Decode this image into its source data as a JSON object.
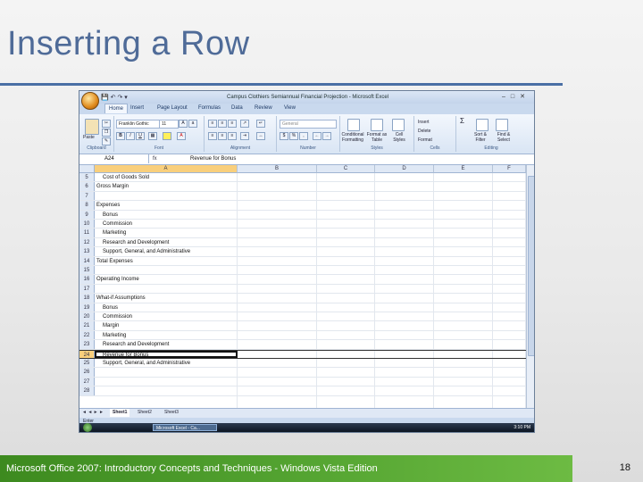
{
  "slide": {
    "title": "Inserting a Row",
    "footer": "Microsoft Office 2007: Introductory Concepts and Techniques - Windows Vista Edition",
    "page_number": "18"
  },
  "excel": {
    "window_title": "Campus Clothiers Semiannual Financial Projection - Microsoft Excel",
    "tabs": [
      "Home",
      "Insert",
      "Page Layout",
      "Formulas",
      "Data",
      "Review",
      "View"
    ],
    "active_tab": "Home",
    "ribbon": {
      "clipboard": {
        "label": "Clipboard",
        "paste": "Paste"
      },
      "font": {
        "label": "Font",
        "font_name": "Franklin Gothic",
        "font_size": "11",
        "bold": "B",
        "italic": "I",
        "underline": "U"
      },
      "alignment": {
        "label": "Alignment"
      },
      "number": {
        "label": "Number",
        "format": "General",
        "currency": "$",
        "percent": "%",
        "comma": ","
      },
      "styles": {
        "label": "Styles",
        "conditional": "Conditional Formatting",
        "format_table": "Format as Table",
        "cell_styles": "Cell Styles"
      },
      "cells": {
        "label": "Cells",
        "insert": "Insert",
        "delete": "Delete",
        "format": "Format"
      },
      "editing": {
        "label": "Editing",
        "sum": "Σ",
        "sort": "Sort & Filter",
        "find": "Find & Select"
      }
    },
    "name_box": "A24",
    "fx": "fx",
    "formula_content": "Revenue for Bonus",
    "columns": [
      "A",
      "B",
      "C",
      "D",
      "E",
      "F"
    ],
    "rows": [
      {
        "num": "5",
        "text": "Cost of Goods Sold",
        "indent": true
      },
      {
        "num": "6",
        "text": "Gross Margin",
        "indent": false
      },
      {
        "num": "7",
        "text": "",
        "indent": false
      },
      {
        "num": "8",
        "text": "Expenses",
        "indent": false
      },
      {
        "num": "9",
        "text": "Bonus",
        "indent": true
      },
      {
        "num": "10",
        "text": "Commission",
        "indent": true
      },
      {
        "num": "11",
        "text": "Marketing",
        "indent": true
      },
      {
        "num": "12",
        "text": "Research and Development",
        "indent": true
      },
      {
        "num": "13",
        "text": "Support, General, and Administrative",
        "indent": true
      },
      {
        "num": "14",
        "text": "Total Expenses",
        "indent": false
      },
      {
        "num": "15",
        "text": "",
        "indent": false
      },
      {
        "num": "16",
        "text": "Operating Income",
        "indent": false
      },
      {
        "num": "17",
        "text": "",
        "indent": false
      },
      {
        "num": "18",
        "text": "What-if Assumptions",
        "indent": false
      },
      {
        "num": "19",
        "text": "Bonus",
        "indent": true
      },
      {
        "num": "20",
        "text": "Commission",
        "indent": true
      },
      {
        "num": "21",
        "text": "Margin",
        "indent": true
      },
      {
        "num": "22",
        "text": "Marketing",
        "indent": true
      },
      {
        "num": "23",
        "text": "Research and Development",
        "indent": true
      },
      {
        "num": "24",
        "text": "Revenue for Bonus",
        "indent": true
      },
      {
        "num": "25",
        "text": "Support, General, and Administrative",
        "indent": true
      },
      {
        "num": "26",
        "text": "",
        "indent": false
      },
      {
        "num": "27",
        "text": "",
        "indent": false
      },
      {
        "num": "28",
        "text": "",
        "indent": false
      }
    ],
    "sheets": [
      "Sheet1",
      "Sheet2",
      "Sheet3"
    ],
    "active_sheet": "Sheet1",
    "status": "Enter",
    "taskbar_item": "Microsoft Excel - Ca...",
    "clock": "3:10 PM"
  }
}
